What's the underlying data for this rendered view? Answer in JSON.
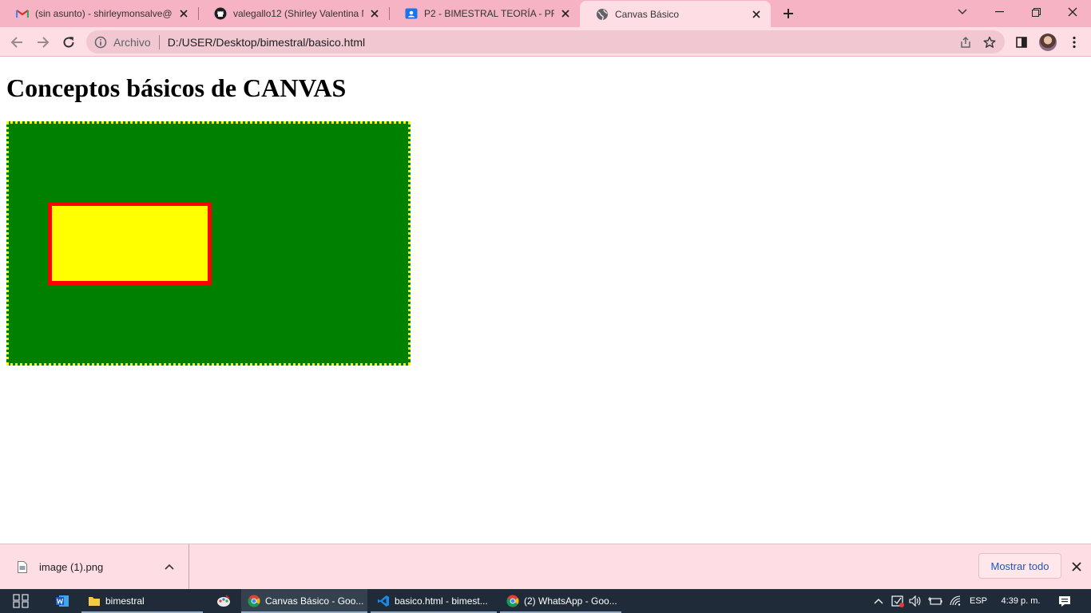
{
  "browser": {
    "tabs": [
      {
        "title": "(sin asunto) - shirleymonsalve@c",
        "icon": "gmail-icon"
      },
      {
        "title": "valegallo12 (Shirley Valentina Mo",
        "icon": "github-icon"
      },
      {
        "title": "P2 - BIMESTRAL TEORÍA - PRÁCT",
        "icon": "classroom-icon"
      },
      {
        "title": "Canvas Básico",
        "icon": "globe-icon",
        "active": true
      }
    ],
    "omnibox": {
      "security_label": "Archivo",
      "url": "D:/USER/Desktop/bimestral/basico.html"
    }
  },
  "page": {
    "heading": "Conceptos básicos de CANVAS",
    "canvas": {
      "background": "#008000",
      "border_color": "#ffff00",
      "rect_fill": "#ffff00",
      "rect_stroke": "#ff0000"
    }
  },
  "downloads": {
    "file_name": "image (1).png",
    "show_all_label": "Mostrar todo"
  },
  "taskbar": {
    "apps": [
      {
        "label": "",
        "icon": "task-view-icon"
      },
      {
        "label": "",
        "icon": "word-icon"
      },
      {
        "label": "bimestral",
        "icon": "folder-icon"
      },
      {
        "label": "",
        "icon": "paint-icon"
      },
      {
        "label": "Canvas Básico - Goo...",
        "icon": "chrome-icon"
      },
      {
        "label": "basico.html - bimest...",
        "icon": "vscode-icon"
      },
      {
        "label": "(2) WhatsApp - Goo...",
        "icon": "chrome-icon"
      }
    ],
    "language": "ESP",
    "clock": "4:39 p. m."
  },
  "colors": {
    "tabstrip": "#f5b3c3",
    "toolbar": "#ffdde5",
    "taskbar": "#1f2b38",
    "link": "#1a56c4"
  }
}
